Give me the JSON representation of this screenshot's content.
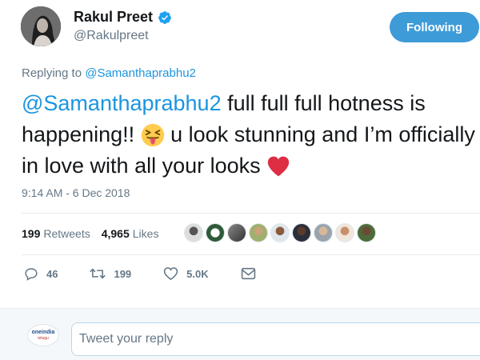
{
  "author": {
    "name": "Rakul Preet",
    "handle": "@Rakulpreet",
    "verified": true
  },
  "follow_button": {
    "label": "Following",
    "color": "#3d9bd7"
  },
  "reply_context": {
    "prefix": "Replying to",
    "mention": "@Samanthaprabhu2"
  },
  "tweet": {
    "mention": "@Samanthaprabhu2",
    "text_1": " full full full hotness is happening!! ",
    "emoji_1": "squinting-face-with-tongue",
    "text_2": " u look stunning and I’m officially in love with all your looks ",
    "emoji_2": "red-heart"
  },
  "timestamp": "9:14 AM - 6 Dec 2018",
  "stats": {
    "retweets_count": "199",
    "retweets_label": "Retweets",
    "likes_count": "4,965",
    "likes_label": "Likes"
  },
  "actions": {
    "replies": "46",
    "retweets": "199",
    "likes": "5.0K"
  },
  "footer": {
    "reply_placeholder": "Tweet your reply",
    "brand_line1": "oneindia",
    "brand_line2": "telugu"
  },
  "colors": {
    "link": "#1b95e0",
    "muted": "#657786",
    "text": "#14171a"
  }
}
